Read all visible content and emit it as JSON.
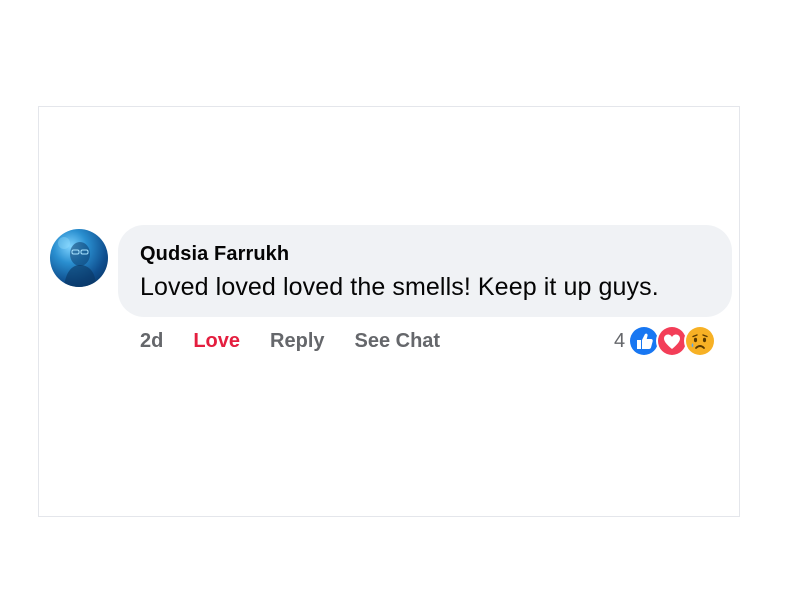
{
  "comment": {
    "author": "Qudsia Farrukh",
    "text": "Loved loved loved the smells! Keep it up guys.",
    "timestamp": "2d",
    "actions": {
      "love": "Love",
      "reply": "Reply",
      "see_chat": "See Chat"
    },
    "reaction_count": "4",
    "reactions": [
      "like-icon",
      "love-icon",
      "sad-icon"
    ]
  },
  "colors": {
    "bubble": "#f0f2f5",
    "love_active": "#e41e3f",
    "meta_text": "#65676b",
    "like_blue": "#1877f2",
    "love_red": "#f33e58",
    "sad_yellow": "#f7b125"
  }
}
